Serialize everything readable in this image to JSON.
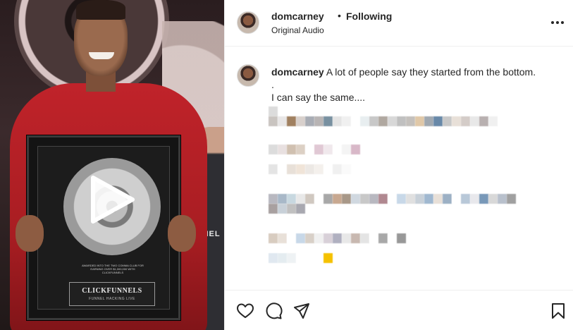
{
  "post": {
    "username": "domcarney",
    "separator": "•",
    "follow_status": "Following",
    "audio_label": "Original Audio"
  },
  "caption": {
    "username": "domcarney",
    "line1": "A lot of people say they started from the bottom.",
    "line2": ".",
    "line3": "I can say the same...."
  },
  "media": {
    "plaque_brand": "CLICKFUNNELS",
    "plaque_sub": "FUNNEL HACKING LIVE",
    "plaque_small": "AWARDED INTO THE TWO COMMA CLUB FOR EARNING OVER $1,000,000 WITH CLICKFUNNELS",
    "side_sign": "FUNNEL"
  },
  "icons": {
    "more": "more-options-icon",
    "like": "heart-icon",
    "comment": "comment-icon",
    "share": "share-icon",
    "save": "bookmark-icon",
    "play": "play-icon"
  },
  "colors": {
    "text": "#262626",
    "divider": "#efefef",
    "emoji_yellow": "#f5c100"
  }
}
